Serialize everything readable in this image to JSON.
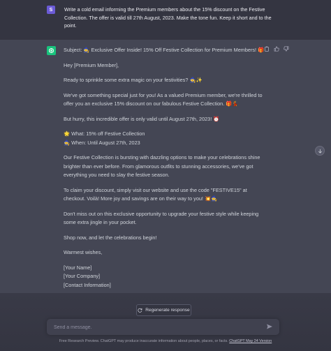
{
  "user": {
    "avatar_letter": "S",
    "message": "Write a cold email informing the Premium members about the 15% discount on the Festive Collection. The offer is valid till 27th August, 2023. Make the tone fun.  Keep it short and to the point."
  },
  "assistant": {
    "subject": "Subject: 🧙 Exclusive Offer Inside! 15% Off Festive Collection for Premium Members! 🎁",
    "greeting": "Hey [Premium Member],",
    "p1": "Ready to sprinkle some extra magic on your festivities? 🧙✨",
    "p2": "We've got something special just for you! As a valued Premium member, we're thrilled to offer you an exclusive 15% discount on our fabulous Festive Collection. 🎁💃",
    "p3": "But hurry, this incredible offer is only valid until August 27th, 2023! ⏰",
    "what": "🌟 What: 15% off Festive Collection",
    "when": "🧙 When: Until August 27th, 2023",
    "p4": "Our Festive Collection is bursting with dazzling options to make your celebrations shine brighter than ever before. From glamorous outfits to stunning accessories, we've got everything you need to slay the festive season.",
    "p5": "To claim your discount, simply visit our website and use the code \"FESTIVE15\" at checkout. Voilà! More joy and savings are on their way to you! 💥🧙",
    "p6": "Don't miss out on this exclusive opportunity to upgrade your festive style while keeping some extra jingle in your pocket.",
    "p7": "Shop now, and let the celebrations begin!",
    "signoff": "Warmest wishes,",
    "name": "[Your Name]",
    "company": "[Your Company]",
    "contact": "[Contact Information]"
  },
  "icons": {
    "copy": "clipboard-icon",
    "like": "thumbs-up-icon",
    "dislike": "thumbs-down-icon",
    "scroll": "arrow-down-icon",
    "regen": "refresh-icon",
    "send": "send-icon"
  },
  "controls": {
    "regenerate_label": "Regenerate response",
    "input_placeholder": "Send a message."
  },
  "footer": {
    "text": "Free Research Preview. ChatGPT may produce inaccurate information about people, places, or facts.",
    "link": "ChatGPT May 24 Version"
  },
  "colors": {
    "background": "#343541",
    "assistant_bg": "#444654",
    "bot_avatar": "#19c37d",
    "user_avatar": "#6b5bd6"
  }
}
